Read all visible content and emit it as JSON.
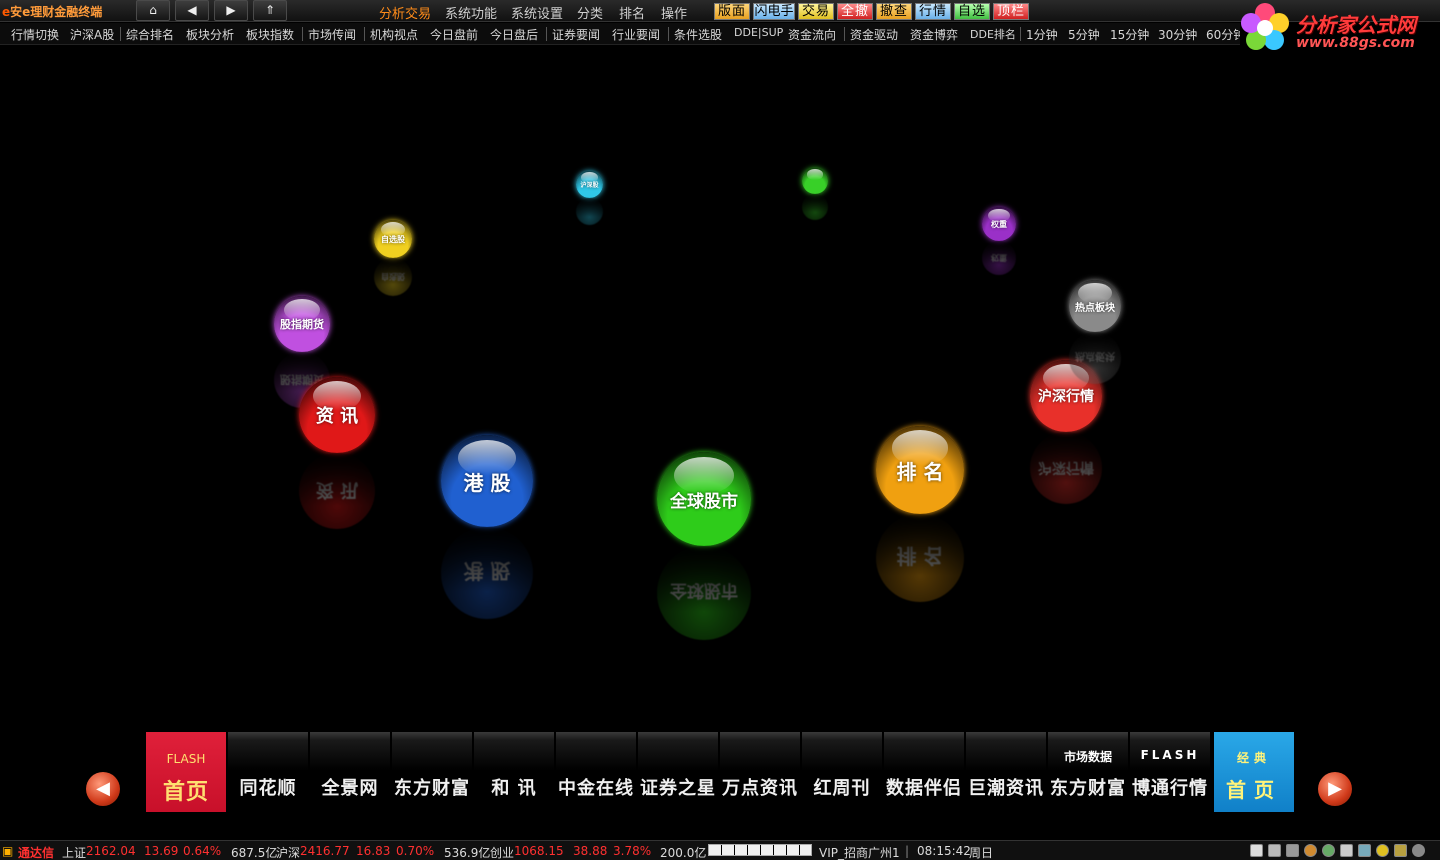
{
  "app": {
    "logo_mark": "e",
    "title": "安e理财金融终端"
  },
  "nav": {
    "home_icon": "⌂",
    "back_icon": "◀",
    "forward_icon": "▶",
    "up_icon": "⇑"
  },
  "menu": [
    {
      "label": "分析交易",
      "active": true
    },
    {
      "label": "系统功能"
    },
    {
      "label": "系统设置"
    },
    {
      "label": "分类"
    },
    {
      "label": "排名"
    },
    {
      "label": "操作"
    }
  ],
  "quick_buttons": [
    {
      "label": "版面",
      "color": "orange"
    },
    {
      "label": "闪电手",
      "color": "blue"
    },
    {
      "label": "交易",
      "color": "yellow"
    },
    {
      "label": "全撤",
      "color": "red"
    },
    {
      "label": "撤查",
      "color": "orange"
    },
    {
      "label": "行情",
      "color": "blue"
    },
    {
      "label": "自选",
      "color": "green"
    },
    {
      "label": "顶栏",
      "color": "red"
    }
  ],
  "brand": {
    "title": "分析家公式网",
    "url": "www.88gs.com"
  },
  "toolbar": [
    "行情切换",
    "沪深A股",
    "综合排名",
    "板块分析",
    "板块指数",
    "市场传闻",
    "机构视点",
    "今日盘前",
    "今日盘后",
    "证券要闻",
    "行业要闻",
    "条件选股",
    "DDE|SUP",
    "资金流向",
    "资金驱动",
    "资金博弈",
    "DDE排名",
    "1分钟",
    "5分钟",
    "15分钟",
    "30分钟",
    "60分钟"
  ],
  "balls": [
    {
      "label": "全球股市",
      "color": "#2ecc1a"
    },
    {
      "label": "排 名",
      "color": "#f0a010"
    },
    {
      "label": "沪深行情",
      "color": "#e8302a"
    },
    {
      "label": "热点板块",
      "color": "#8a8a8a"
    },
    {
      "label": "权重",
      "color": "#9a30c8"
    },
    {
      "label": "",
      "color": "#38d028"
    },
    {
      "label": "沪深股",
      "color": "#30c8e8"
    },
    {
      "label": "自选股",
      "color": "#f0d020"
    },
    {
      "label": "股指期货",
      "color": "#c050e0"
    },
    {
      "label": "资 讯",
      "color": "#e01818"
    },
    {
      "label": "港 股",
      "color": "#2060d0"
    }
  ],
  "tabs": [
    {
      "sub": "FLASH",
      "label": "首页",
      "style": "hl-red"
    },
    {
      "sub": "",
      "label": "同花顺"
    },
    {
      "sub": "",
      "label": "全景网"
    },
    {
      "sub": "",
      "label": "东方财富"
    },
    {
      "sub": "",
      "label": "和 讯"
    },
    {
      "sub": "",
      "label": "中金在线"
    },
    {
      "sub": "",
      "label": "证券之星"
    },
    {
      "sub": "",
      "label": "万点资讯"
    },
    {
      "sub": "",
      "label": "红周刊"
    },
    {
      "sub": "",
      "label": "数据伴侣"
    },
    {
      "sub": "",
      "label": "巨潮资讯"
    },
    {
      "sub": "市场数据",
      "label": "东方财富"
    },
    {
      "sub": "FLASH",
      "label": "博通行情"
    },
    {
      "sub": "经典",
      "label": "首页",
      "style": "hl-blue"
    }
  ],
  "arrows": {
    "prev": "◀",
    "next": "▶"
  },
  "status": {
    "brand": "通达信",
    "sh_label": "上证",
    "sh_index": "2162.04",
    "sh_change": "13.69",
    "sh_pct": "0.64%",
    "sh_amount": "687.5亿",
    "hs_label": "沪深",
    "hs_index": "2416.77",
    "hs_change": "16.83",
    "hs_pct": "0.70%",
    "hs_amount": "536.9亿",
    "cy_label": "创业",
    "cy_index": "1068.15",
    "cy_change": "38.88",
    "cy_pct": "3.78%",
    "cy_amount": "200.0亿",
    "server": "VIP_招商广州1",
    "time": "08:15:42",
    "weekday": "周日"
  }
}
